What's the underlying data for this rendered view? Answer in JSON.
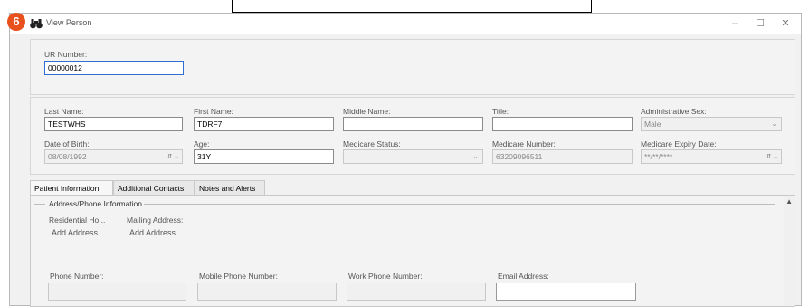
{
  "step_badge": "6",
  "window": {
    "title": "View Person",
    "minimize": "–",
    "maximize": "☐",
    "close": "✕"
  },
  "ur": {
    "label": "UR Number:",
    "value": "00000012"
  },
  "person": {
    "last_name": {
      "label": "Last Name:",
      "value": "TESTWHS"
    },
    "first_name": {
      "label": "First Name:",
      "value": "TDRF7"
    },
    "middle_name": {
      "label": "Middle Name:",
      "value": ""
    },
    "title": {
      "label": "Title:",
      "value": ""
    },
    "admin_sex": {
      "label": "Administrative Sex:",
      "value": "Male"
    },
    "dob": {
      "label": "Date of Birth:",
      "value": "08/08/1992"
    },
    "age": {
      "label": "Age:",
      "value": "31Y"
    },
    "medicare_status": {
      "label": "Medicare Status:",
      "value": ""
    },
    "medicare_number": {
      "label": "Medicare Number:",
      "value": "63209096511"
    },
    "medicare_expiry": {
      "label": "Medicare Expiry Date:",
      "value": "**/**/****"
    }
  },
  "tabs": [
    "Patient Information",
    "Additional Contacts",
    "Notes and Alerts"
  ],
  "address": {
    "group_title": "Address/Phone Information",
    "residential_label": "Residential Ho...",
    "mailing_label": "Mailing Address:",
    "add_address": "Add Address..."
  },
  "phones": {
    "phone_label": "Phone Number:",
    "mobile_label": "Mobile Phone Number:",
    "work_label": "Work Phone Number:",
    "email_label": "Email Address:"
  }
}
